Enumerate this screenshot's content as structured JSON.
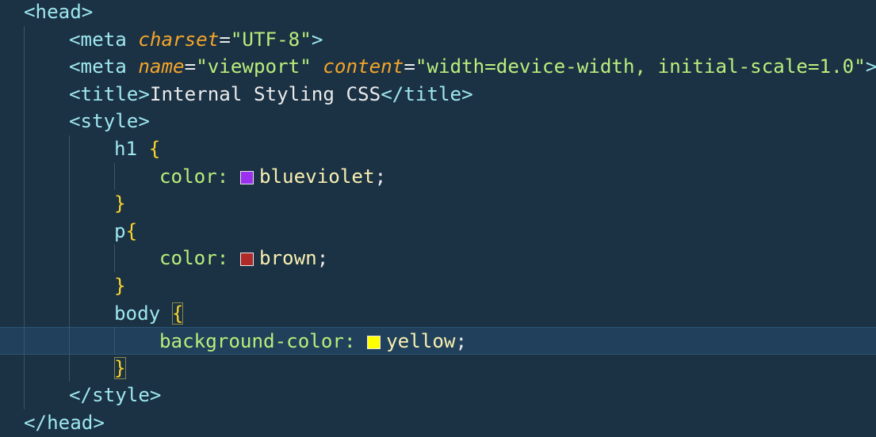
{
  "lines": [
    {
      "indent": 0,
      "tokens": [
        {
          "t": "<head>",
          "c": "tag"
        }
      ]
    },
    {
      "indent": 1,
      "tokens": [
        {
          "t": "<meta ",
          "c": "tag"
        },
        {
          "t": "charset",
          "c": "attr"
        },
        {
          "t": "=",
          "c": "punc"
        },
        {
          "t": "\"UTF-8\"",
          "c": "str"
        },
        {
          "t": ">",
          "c": "tag"
        }
      ]
    },
    {
      "indent": 1,
      "tokens": [
        {
          "t": "<meta ",
          "c": "tag"
        },
        {
          "t": "name",
          "c": "attr"
        },
        {
          "t": "=",
          "c": "punc"
        },
        {
          "t": "\"viewport\" ",
          "c": "str"
        },
        {
          "t": "content",
          "c": "attr"
        },
        {
          "t": "=",
          "c": "punc"
        },
        {
          "t": "\"width=device-width, initial-scale=1.0\"",
          "c": "str"
        },
        {
          "t": ">",
          "c": "tag"
        }
      ]
    },
    {
      "indent": 1,
      "tokens": [
        {
          "t": "<title>",
          "c": "tag"
        },
        {
          "t": "Internal Styling CSS",
          "c": "txt"
        },
        {
          "t": "</title>",
          "c": "tag"
        }
      ]
    },
    {
      "indent": 1,
      "tokens": [
        {
          "t": "<style>",
          "c": "tag"
        }
      ]
    },
    {
      "indent": 2,
      "tokens": [
        {
          "t": "h1 ",
          "c": "sel"
        },
        {
          "t": "{",
          "c": "brace"
        }
      ]
    },
    {
      "indent": 3,
      "tokens": [
        {
          "t": "color: ",
          "c": "prop"
        },
        {
          "swatch": "#9b30f0"
        },
        {
          "t": "blueviolet",
          "c": "val"
        },
        {
          "t": ";",
          "c": "punc"
        }
      ]
    },
    {
      "indent": 2,
      "tokens": [
        {
          "t": "}",
          "c": "brace"
        }
      ]
    },
    {
      "indent": 2,
      "tokens": [
        {
          "t": "p",
          "c": "sel"
        },
        {
          "t": "{",
          "c": "brace"
        }
      ]
    },
    {
      "indent": 3,
      "tokens": [
        {
          "t": "color: ",
          "c": "prop"
        },
        {
          "swatch": "#b12a2a"
        },
        {
          "t": "brown",
          "c": "val"
        },
        {
          "t": ";",
          "c": "punc"
        }
      ]
    },
    {
      "indent": 2,
      "tokens": [
        {
          "t": "}",
          "c": "brace"
        }
      ]
    },
    {
      "indent": 2,
      "tokens": [
        {
          "t": "body ",
          "c": "sel"
        },
        {
          "t": "{",
          "c": "brace",
          "match": true
        }
      ]
    },
    {
      "indent": 3,
      "current": true,
      "tokens": [
        {
          "t": "background-color: ",
          "c": "prop"
        },
        {
          "swatch": "#ffff00"
        },
        {
          "t": "yellow",
          "c": "val"
        },
        {
          "t": ";",
          "c": "punc"
        }
      ]
    },
    {
      "indent": 2,
      "tokens": [
        {
          "t": "}",
          "c": "brace",
          "match": true
        }
      ]
    },
    {
      "indent": 1,
      "tokens": [
        {
          "t": "</style>",
          "c": "tag"
        }
      ]
    },
    {
      "indent": 0,
      "tokens": [
        {
          "t": "</head>",
          "c": "tag"
        }
      ]
    }
  ]
}
